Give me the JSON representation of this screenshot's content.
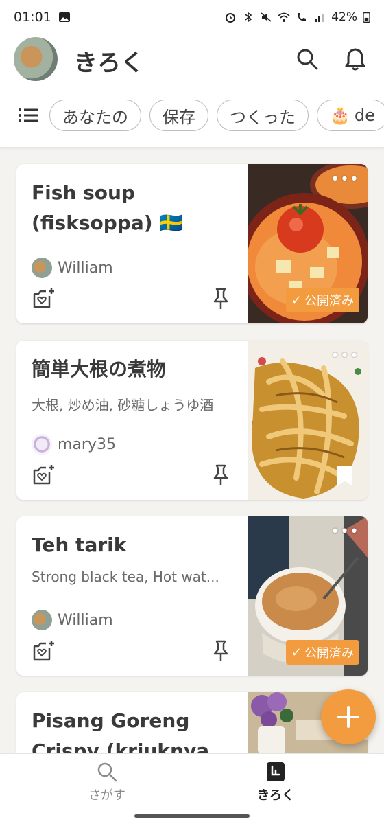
{
  "status_bar": {
    "time": "01:01",
    "battery": "42%"
  },
  "header": {
    "title": "きろく"
  },
  "chips": [
    {
      "label": "あなたの"
    },
    {
      "label": "保存"
    },
    {
      "label": "つくった"
    },
    {
      "label": "de",
      "emoji": "🎂"
    }
  ],
  "recipes": [
    {
      "title": "Fish soup (fisksoppa) 🇸🇪",
      "ingredients": "",
      "author": "William",
      "badge": "公開済み",
      "check": "✓",
      "more": "•••"
    },
    {
      "title": "簡単大根の煮物",
      "ingredients": "大根, 炒め油, 砂糖しょうゆ酒",
      "author": "mary35",
      "badge": "",
      "more": "•••"
    },
    {
      "title": "Teh tarik",
      "ingredients": "Strong black tea, Hot wat...",
      "author": "William",
      "badge": "公開済み",
      "check": "✓",
      "more": "•••"
    },
    {
      "title": "Pisang Goreng Crispy (kriuknya t...",
      "ingredients": "",
      "author": "",
      "badge": ""
    }
  ],
  "bottom_nav": {
    "search_label": "さがす",
    "kiroku_label": "きろく"
  },
  "colors": {
    "accent": "#f39c3f",
    "background": "#f4f3ef"
  }
}
